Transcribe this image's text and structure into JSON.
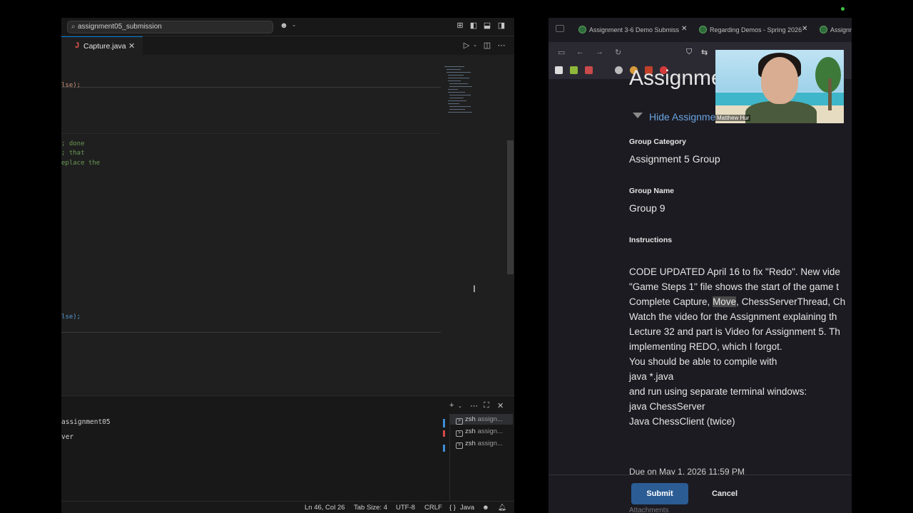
{
  "vscode": {
    "search_text": "assignment05_submission",
    "tab": {
      "icon": "J",
      "label": "Capture.java"
    },
    "code_lines": [
      {
        "text": "lse);",
        "kind": "code"
      },
      {
        "text": "; done",
        "kind": "comment"
      },
      {
        "text": "; that",
        "kind": "comment"
      },
      {
        "text": "eplace the",
        "kind": "comment"
      },
      {
        "text": "lse);",
        "kind": "code"
      }
    ],
    "terminal_lines": [
      "assignment05",
      "ver"
    ],
    "terminal_list": [
      {
        "shell": "zsh",
        "name": "assign..."
      },
      {
        "shell": "zsh",
        "name": "assign..."
      },
      {
        "shell": "zsh",
        "name": "assign..."
      }
    ],
    "status": {
      "position": "Ln 46, Col 26",
      "tab_size": "Tab Size: 4",
      "encoding": "UTF-8",
      "eol": "CRLF",
      "language": "Java",
      "language_icon": "{ }"
    }
  },
  "browser": {
    "tabs": [
      {
        "label": "Assignment 3-6 Demo Submiss"
      },
      {
        "label": "Regarding Demos - Spring 2026"
      },
      {
        "label": "Assignm"
      }
    ],
    "heading": "Assignme",
    "hide_link": "Hide Assignme",
    "group_category_label": "Group Category",
    "group_category_value": "Assignment 5 Group",
    "group_name_label": "Group Name",
    "group_name_value": "Group 9",
    "instructions_label": "Instructions",
    "instructions": {
      "line1": "CODE UPDATED April 16 to fix \"Redo\". New vide",
      "line2": "\"Game Steps 1\" file shows the start of the game t",
      "line3_pre": "Complete Capture, ",
      "line3_hl": "Move",
      "line3_post": ", ChessServerThread, Ch",
      "line4": "Watch the video for the Assignment explaining th",
      "line5": "Lecture 32 and part is Video for Assignment 5. Th",
      "line6": "implementing REDO, which I forgot.",
      "line7": "You should be able to compile with",
      "line8": "java *.java",
      "line9": "and run using separate terminal windows:",
      "line10": "java ChessServer",
      "line11": "Java ChessClient (twice)"
    },
    "due_text": "Due on May 1, 2026 11:59 PM",
    "attachments_text": "Attachments",
    "submit_label": "Submit",
    "cancel_label": "Cancel"
  },
  "video": {
    "participant_name": "Matthew Hur"
  }
}
